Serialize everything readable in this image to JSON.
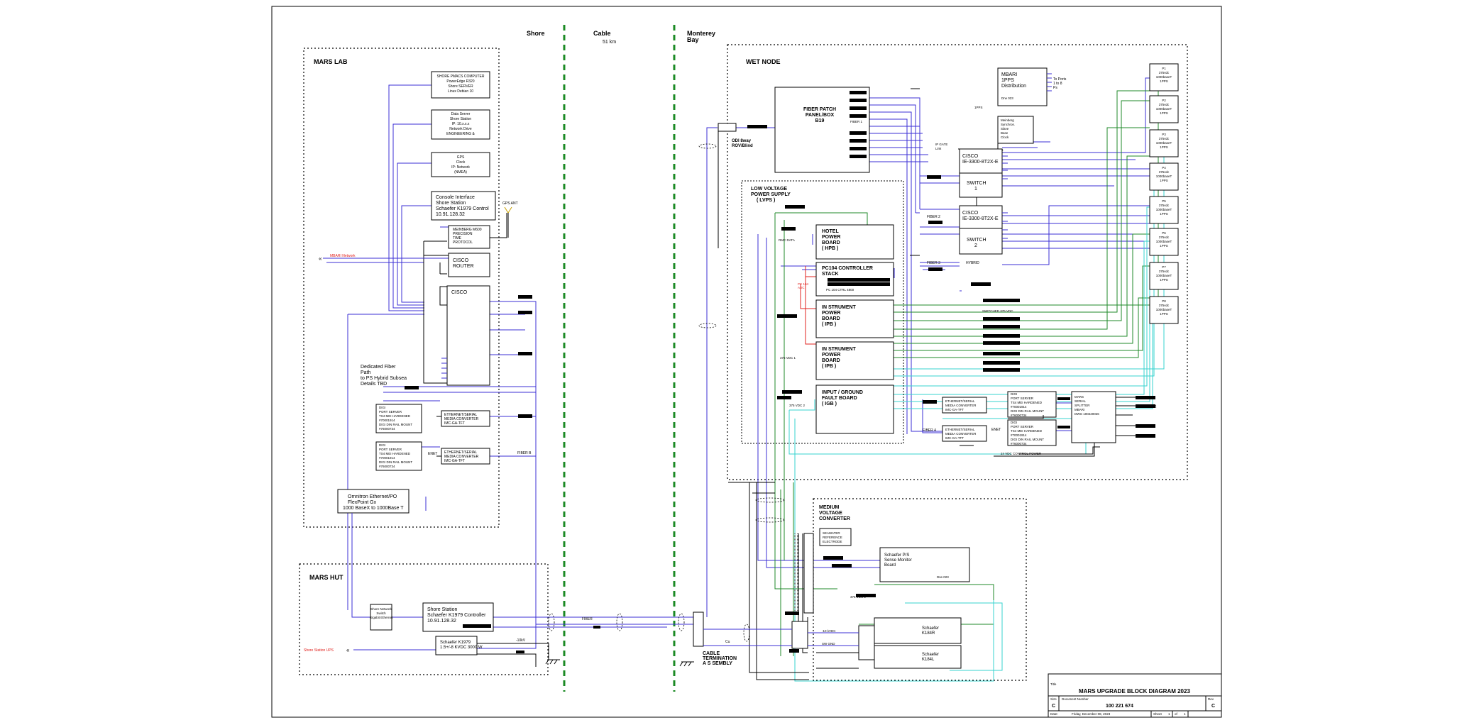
{
  "colors": {
    "blue": "#3b2fd6",
    "green": "#1f8a2a",
    "cyan": "#37d3cf",
    "red": "#e0201c",
    "black": "#000000",
    "boundary_green": "#1b8a24"
  },
  "regions": {
    "shore": "Shore",
    "cable": "Cable",
    "cable_length": "51 km",
    "monterey_bay_1": "Monterey",
    "monterey_bay_2": "Bay"
  },
  "mars_lab": {
    "title": "MARS LAB",
    "box_shore_pc": [
      "SHORE PMACS COMPUTER",
      "PowerEdge R320",
      "Shore SERVER",
      "Linux Debian 10"
    ],
    "box_data_server": [
      "Data Server",
      "Shore Station",
      "IP: 10.x.x.x",
      "Network Drive",
      "ENGINEERING &"
    ],
    "box_gps": [
      "GPS",
      "Clock",
      "IP: Network",
      "(NMEA)"
    ],
    "console_interface": [
      "Console Interface",
      "Shore Station",
      "Schaefer K1979 Control",
      "10.91.128.32"
    ],
    "meinberg": [
      "MEINBERG M600",
      "PRECISION",
      "TIME",
      "PROTOCOL"
    ],
    "gps_ant": "GPS ANT",
    "mbari_network": "MBARI Network",
    "cisco_router": [
      "CISCO",
      "ROUTER"
    ],
    "cisco": "CISCO",
    "dedicated_fiber": [
      "Dedicated Fiber",
      "Path",
      "to PS Hybrid Subsea",
      "Details TBD"
    ],
    "serial_server_1": [
      "DIGI",
      "PORT SERVER",
      "TS4 MEI HARDENED",
      "#70001914",
      "DIGI DIN RAIL MOUNT",
      "#76000734"
    ],
    "serial_server_2": [
      "DIGI",
      "PORT SERVER",
      "TS4 MEI HARDENED",
      "#70001914",
      "DIGI DIN RAIL MOUNT",
      "#76000734"
    ],
    "media_conv_1": [
      "ETHERNET/SERIAL",
      "MEDIA CONVERTER",
      "IMC-GA-TFT"
    ],
    "media_conv_2": [
      "ETHERNET/SERIAL",
      "MEDIA CONVERTER",
      "IMC-GA-TFT"
    ],
    "enet_label": "ENET",
    "fiber_b_label": "FIBER B",
    "omnitron": [
      "Omnitron Ethernet/PO",
      "FlexPoint Gx",
      "1000 BaseX to 1000Base T"
    ]
  },
  "mars_hut": {
    "title": "MARS HUT",
    "hotkey_switch": [
      "Shore Network",
      "Switch",
      "Gigabit Ethernet"
    ],
    "shore_station": [
      "Shore Station",
      "Schaefer K1979 Controller",
      "10.91.128.32"
    ],
    "schaefer_k1979": [
      "Schaefer K1979",
      "1.5+/-8 KVDC 3000 W"
    ],
    "shore_station_ups": "Shore Station UPS",
    "hvdc_label": "-10kV",
    "fiber_label": "FIBER"
  },
  "wet_node": {
    "title": "WET NODE",
    "fiber_patch": [
      "FIBER PATCH",
      "PANEL/BOX",
      "B19"
    ],
    "fiber_1": "FIBER 1",
    "odi": [
      "ODI 8way",
      "ROV/Blind"
    ],
    "mbari_1pps": [
      "MBARI",
      "1PPS",
      "Distribution"
    ],
    "mbari_1pps_note": "Drw 023",
    "pps_to_ports": [
      "To Ports",
      "1 to 8",
      "Ps"
    ],
    "meinberg_node": [
      "Meinberg",
      "Synchron.",
      "Slave",
      "Base",
      "Clock"
    ],
    "pps_small": "1PPS",
    "pps_small2": "1PS",
    "cisco_1": [
      "CISCO",
      "IE-3300-8T2X-E"
    ],
    "switch_1": [
      "SWITCH",
      "1"
    ],
    "cisco_2": [
      "CISCO",
      "IE-3300-8T2X-E"
    ],
    "switch_2": [
      "SWITCH",
      "2"
    ],
    "ip_labels": [
      "IP GATE",
      "Link"
    ],
    "fiber_2": "FIBER 2",
    "fiber_3": "FIBER 3",
    "fiber_4": "FIBER 4",
    "hybrid": "HYBRID",
    "lvps_title": [
      "LOW VOLTAGE",
      "POWER SUPPLY",
      "( LVPS )"
    ],
    "hpb": [
      "HOTEL",
      "POWER",
      "BOARD",
      "( HPB )"
    ],
    "pc104": [
      "PC104 CONTROLLER",
      "STACK"
    ],
    "pc104_note": "PC 104 CTRL 4800",
    "pc104_side": [
      "PC 104",
      "ADC"
    ],
    "ipb_1": [
      "IN STRUMENT",
      "POWER",
      "BOARD",
      "( IPB )"
    ],
    "ipb_2": [
      "IN STRUMENT",
      "POWER",
      "BOARD",
      "( IPB )"
    ],
    "igb": [
      "INPUT / GROUND",
      "FAULT BOARD",
      "( IGB )"
    ],
    "rmc_data": "RMC DATA",
    "vdc_375_1": "375 VDC 1",
    "vdc_375_2": "375 VDC 2",
    "switched_375": "SWITCHED 375 VDC",
    "serial_server_a": [
      "DIGI",
      "PORT SERVER",
      "TS4 MEI HARDENED",
      "#70001914",
      "DIGI DIN RAIL MOUNT",
      "#76000734"
    ],
    "serial_server_b": [
      "DIGI",
      "PORT SERVER",
      "TS4 MEI HARDENED",
      "#70001914",
      "DIGI DIN RAIL MOUNT",
      "#76000734"
    ],
    "media_conv_a": [
      "ETHERNET/SERIAL",
      "MEDIA CONVERTER",
      "IMC-GA-TFT"
    ],
    "media_conv_b": [
      "ETHERNET/SERIAL",
      "MEDIA CONVERTER",
      "IMC-GA-TFT"
    ],
    "enet": "ENET",
    "mars_serial_splitter": [
      "MARS",
      "SERIAL",
      "SPLITTER",
      "MBARI",
      "DWG 100220026"
    ],
    "cisco_sw2_label": "CISCO SW 2",
    "vdc_24_label": "24 VDC CONTROL POWER",
    "ports": [
      [
        "P1",
        "375vdc",
        "1000baseT",
        "1PPS"
      ],
      [
        "P2",
        "375vdc",
        "1000baseT",
        "1PPS"
      ],
      [
        "P3",
        "375vdc",
        "1000baseT",
        "1PPS"
      ],
      [
        "P4",
        "375vdc",
        "1000baseT",
        "1PPS"
      ],
      [
        "P5",
        "375vdc",
        "1000baseT",
        "1PPS"
      ],
      [
        "P6",
        "375vdc",
        "1000baseT",
        "1PPS"
      ],
      [
        "P7",
        "375vdc",
        "1000baseT",
        "1PPS"
      ],
      [
        "P8",
        "375vdc",
        "1000baseT",
        "1PPS"
      ]
    ]
  },
  "mvc": {
    "title": [
      "MEDIUM",
      "VOLTAGE",
      "CONVERTER"
    ],
    "seawater": [
      "SEAWATER",
      "REFERENCE",
      "ELECTRODE"
    ],
    "schaefer_ps": [
      "Schaefer P/S",
      "Sense Monitor",
      "Board"
    ],
    "schaefer_ps_note": "Drw 023",
    "schaefer_k184r": [
      "Schaefer",
      "K184R"
    ],
    "schaefer_k184l": [
      "Schaefer",
      "K184L"
    ],
    "vdc_375_3": "375 VDC 1",
    "hvdc_10kv": "-10 kVDC",
    "sw_gnd": "SW GND",
    "cu_label": "Cu"
  },
  "cable_termination": [
    "CABLE",
    "TERMINATION",
    "A S SEMBLY"
  ],
  "title_block": {
    "title": "MARS UPGRADE BLOCK DIAGRAM 2023",
    "size_label": "Size",
    "size": "C",
    "doc_number_label": "Document Number",
    "doc_number": "100 221 674",
    "rev_label": "Rev",
    "rev": "C",
    "date_label": "Date:",
    "date": "Friday, December 08, 2023",
    "sheet_label": "Sheet",
    "sheet": "1",
    "of_label": "of",
    "of": "1",
    "title_label": "Title"
  }
}
